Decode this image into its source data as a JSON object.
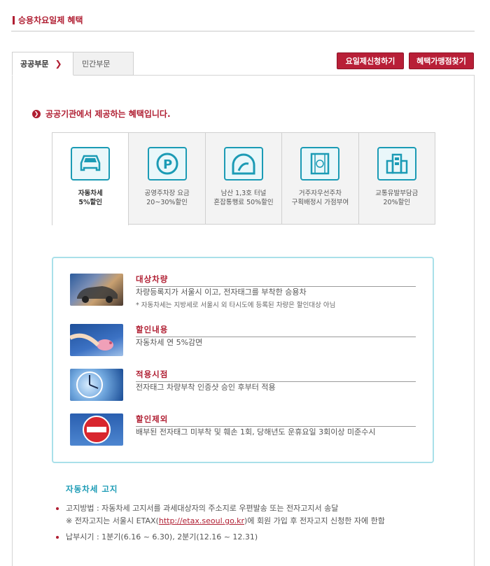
{
  "page_title": "승용차요일제 혜택",
  "tabs": [
    {
      "label": "공공부문",
      "chevron": "❯",
      "active": true
    },
    {
      "label": "민간부문",
      "active": false
    }
  ],
  "buttons": {
    "apply": "요일제신청하기",
    "find": "혜택가맹점찾기"
  },
  "intro": {
    "text": "공공기관에서 제공하는 혜택입니다.",
    "icon": "chevron-right-icon"
  },
  "benefits": [
    {
      "icon": "car-icon",
      "line1": "자동차세",
      "line2": "5%할인"
    },
    {
      "icon": "parking-icon",
      "line1": "공영주차장 요금",
      "line2": "20~30%할인"
    },
    {
      "icon": "tunnel-icon",
      "line1": "남산 1,3호 터널",
      "line2": "혼잡통행료 50%할인"
    },
    {
      "icon": "resident-parking-icon",
      "line1": "거주자우선주차",
      "line2": "구획배정시 가점부여"
    },
    {
      "icon": "building-icon",
      "line1": "교통유발부담금",
      "line2": "20%할인"
    }
  ],
  "info": [
    {
      "title": "대상차량",
      "body": "차량등록지가 서울시 이고, 전자태그를 부착한 승용차",
      "note": "* 자동차세는 지방세로 서울시 외 타시도에 등록된 차량은 할인대상 아님",
      "image": "car-photo"
    },
    {
      "title": "할인내용",
      "body": "자동차세 연 5%감면",
      "image": "piggy-bank-photo"
    },
    {
      "title": "적용시점",
      "body": "전자태그 차량부착 인증샷 승인 후부터 적용",
      "image": "clock-photo"
    },
    {
      "title": "할인제외",
      "body": "배부된 전자태그 미부착 및 훼손 1회, 당해년도 운휴요일 3회이상 미준수시",
      "image": "no-entry-sign-photo"
    }
  ],
  "tax": {
    "title": "자동차세 고지",
    "items": [
      {
        "text": "고지방법 : 자동차세 고지서를 과세대상자의 주소지로 우편발송 또는 전자고지서 송달",
        "sub_before": "※ 전자고지는 서울시 ETAX(",
        "link": "http://etax.seoul.go.kr",
        "sub_after": ")에 회원 가입 후 전자고지 신청한 자에 한함"
      },
      {
        "text": "납부시기 : 1분기(6.16 ~ 6.30), 2분기(12.16 ~ 12.31)"
      }
    ]
  },
  "colors": {
    "accent": "#b01e32",
    "teal": "#1b9bb5"
  }
}
